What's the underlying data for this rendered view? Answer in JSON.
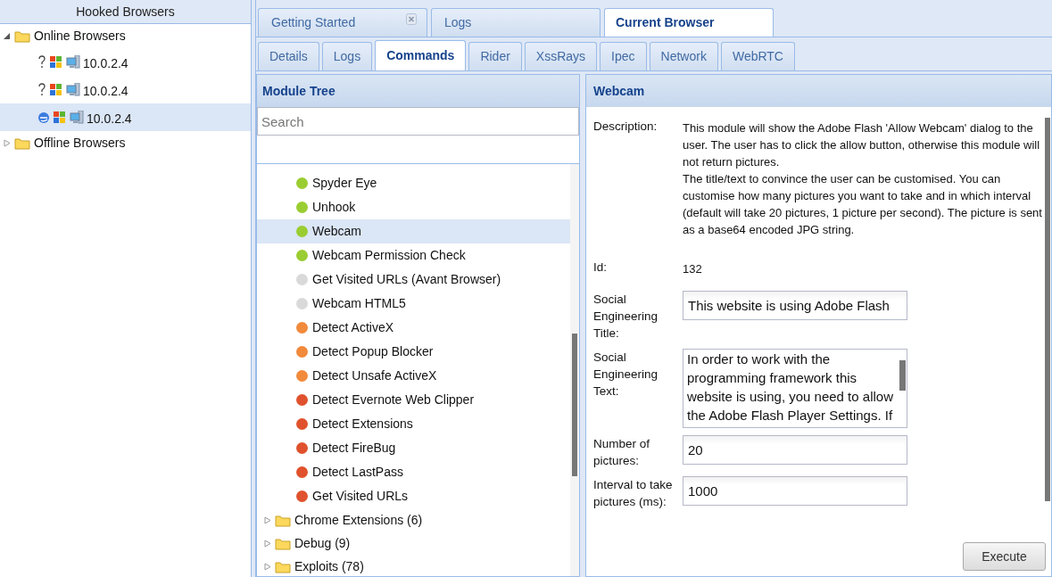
{
  "hooked_browsers": {
    "title": "Hooked Browsers",
    "groups": [
      {
        "label": "Online Browsers",
        "expanded": true,
        "children": [
          {
            "label": "10.0.2.4",
            "kind": "unknown",
            "selected": false
          },
          {
            "label": "10.0.2.4",
            "kind": "unknown",
            "selected": false
          },
          {
            "label": "10.0.2.4",
            "kind": "ie",
            "selected": true
          }
        ]
      },
      {
        "label": "Offline Browsers",
        "expanded": false
      }
    ]
  },
  "main_tabs": [
    {
      "label": "Getting Started",
      "selected": false,
      "closable": true
    },
    {
      "label": "Logs",
      "selected": false,
      "closable": false
    },
    {
      "label": "Current Browser",
      "selected": true,
      "closable": false
    }
  ],
  "sub_tabs": [
    {
      "label": "Details",
      "selected": false
    },
    {
      "label": "Logs",
      "selected": false
    },
    {
      "label": "Commands",
      "selected": true
    },
    {
      "label": "Rider",
      "selected": false
    },
    {
      "label": "XssRays",
      "selected": false
    },
    {
      "label": "Ipec",
      "selected": false
    },
    {
      "label": "Network",
      "selected": false
    },
    {
      "label": "WebRTC",
      "selected": false
    }
  ],
  "module_tree": {
    "title": "Module Tree",
    "search": {
      "placeholder": "Search"
    },
    "items": [
      {
        "kind": "module",
        "label": "Spyder Eye",
        "color": "#9acd32",
        "selected": false
      },
      {
        "kind": "module",
        "label": "Unhook",
        "color": "#9acd32",
        "selected": false
      },
      {
        "kind": "module",
        "label": "Webcam",
        "color": "#9acd32",
        "selected": true
      },
      {
        "kind": "module",
        "label": "Webcam Permission Check",
        "color": "#9acd32",
        "selected": false
      },
      {
        "kind": "module",
        "label": "Get Visited URLs (Avant Browser)",
        "color": "#d9d9d9",
        "selected": false
      },
      {
        "kind": "module",
        "label": "Webcam HTML5",
        "color": "#d9d9d9",
        "selected": false
      },
      {
        "kind": "module",
        "label": "Detect ActiveX",
        "color": "#f28a3c",
        "selected": false
      },
      {
        "kind": "module",
        "label": "Detect Popup Blocker",
        "color": "#f28a3c",
        "selected": false
      },
      {
        "kind": "module",
        "label": "Detect Unsafe ActiveX",
        "color": "#f28a3c",
        "selected": false
      },
      {
        "kind": "module",
        "label": "Detect Evernote Web Clipper",
        "color": "#e0522d",
        "selected": false
      },
      {
        "kind": "module",
        "label": "Detect Extensions",
        "color": "#e0522d",
        "selected": false
      },
      {
        "kind": "module",
        "label": "Detect FireBug",
        "color": "#e0522d",
        "selected": false
      },
      {
        "kind": "module",
        "label": "Detect LastPass",
        "color": "#e0522d",
        "selected": false
      },
      {
        "kind": "module",
        "label": "Get Visited URLs",
        "color": "#e0522d",
        "selected": false
      },
      {
        "kind": "folder",
        "label": "Chrome Extensions (6)",
        "selected": false
      },
      {
        "kind": "folder",
        "label": "Debug (9)",
        "selected": false
      },
      {
        "kind": "folder",
        "label": "Exploits (78)",
        "selected": false
      }
    ]
  },
  "module_panel": {
    "title": "Webcam",
    "fields": [
      {
        "kind": "text",
        "label": "Description:",
        "value": "This module will show the Adobe Flash 'Allow Webcam' dialog to the user. The user has to click the allow button, otherwise this module will not return pictures.\nThe title/text to convince the user can be customised. You can customise how many pictures you want to take and in which interval (default will take 20 pictures, 1 picture per second). The picture is sent as a base64 encoded JPG string."
      },
      {
        "kind": "text",
        "label": "Id:",
        "value": "132"
      },
      {
        "kind": "input",
        "label": "Social Engineering Title:",
        "value": "This website is using Adobe Flash"
      },
      {
        "kind": "textarea",
        "label": "Social Engineering Text:",
        "value": "In order to work with the programming framework this website is using, you need to allow the Adobe Flash Player Settings. If"
      },
      {
        "kind": "input",
        "label": "Number of pictures:",
        "value": "20"
      },
      {
        "kind": "input",
        "label": "Interval to take pictures (ms):",
        "value": "1000"
      }
    ],
    "button": "Execute"
  }
}
